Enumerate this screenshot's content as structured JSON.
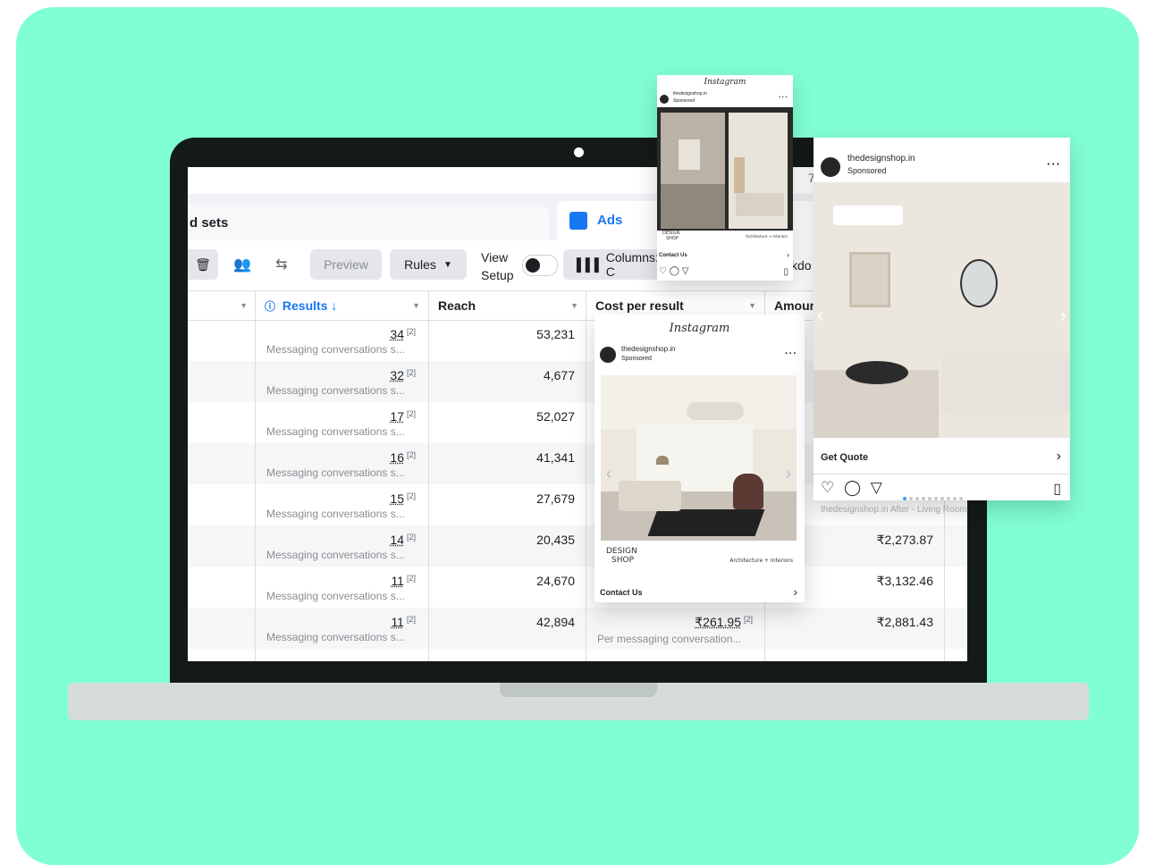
{
  "toolbar": {
    "tab_adsets": "d sets",
    "tab_ads": "Ads",
    "preview": "Preview",
    "rules": "Rules",
    "view_line1": "View",
    "view_line2": "Setup",
    "columns": "Columns: C",
    "breakdown": "kdo",
    "top_partial": "7"
  },
  "columns": {
    "results": "Results",
    "reach": "Reach",
    "cost_per_result": "Cost per result",
    "amount": "Amoun"
  },
  "rows": [
    {
      "results": "34",
      "sup": "[2]",
      "sub": "Messaging conversations s...",
      "reach": "53,231",
      "cpr": "",
      "cpr_sub": "",
      "amount": ""
    },
    {
      "results": "32",
      "sup": "[2]",
      "sub": "Messaging conversations s...",
      "reach": "4,677",
      "cpr": "",
      "cpr_sub": "",
      "amount": ""
    },
    {
      "results": "17",
      "sup": "[2]",
      "sub": "Messaging conversations s...",
      "reach": "52,027",
      "cpr": "",
      "cpr_sub": "",
      "amount": ""
    },
    {
      "results": "16",
      "sup": "[2]",
      "sub": "Messaging conversations s...",
      "reach": "41,341",
      "cpr": "",
      "cpr_sub": "",
      "amount": ""
    },
    {
      "results": "15",
      "sup": "[2]",
      "sub": "Messaging conversations s...",
      "reach": "27,679",
      "cpr": "",
      "cpr_sub": "",
      "amount": ""
    },
    {
      "results": "14",
      "sup": "[2]",
      "sub": "Messaging conversations s...",
      "reach": "20,435",
      "cpr": "",
      "cpr_sub": "",
      "amount": "₹2,273.87"
    },
    {
      "results": "11",
      "sup": "[2]",
      "sub": "Messaging conversations s...",
      "reach": "24,670",
      "cpr": "",
      "cpr_sub": "",
      "amount": "₹3,132.46"
    },
    {
      "results": "11",
      "sup": "[2]",
      "sub": "Messaging conversations s...",
      "reach": "42,894",
      "cpr": "₹261.95",
      "cpr_sub": "Per messaging conversation...",
      "amount": "₹2,881.43"
    }
  ],
  "ig_small": {
    "logo": "Instagram",
    "user": "thedesignshop.in",
    "sponsored": "Sponsored",
    "brand_l1": "DESIGN",
    "brand_l2": "SHOP",
    "tagline": "Architecture + Interiors",
    "cta": "Contact Us"
  },
  "ig_mid": {
    "logo": "Instagram",
    "user": "thedesignshop.in",
    "sponsored": "Sponsored",
    "brand_l1": "DESIGN",
    "brand_l2": "SHOP",
    "tagline": "Architecture + Interiors",
    "cta": "Contact Us"
  },
  "ig_right": {
    "user": "thedesignshop.in",
    "sponsored": "Sponsored",
    "cta": "Get Quote",
    "caption": "thedesignshop.in After - Living Room"
  },
  "colors": {
    "background": "#80ffd2",
    "accent": "#1877f2"
  }
}
